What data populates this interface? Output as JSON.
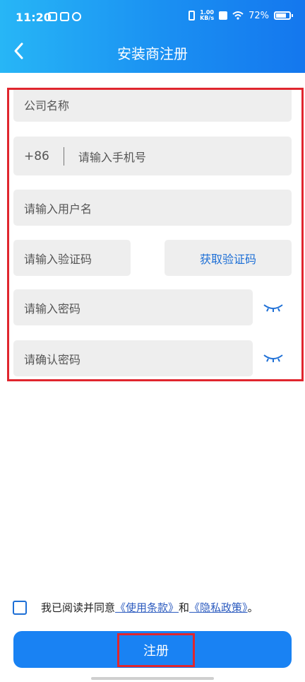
{
  "status": {
    "time": "11:20",
    "net_speed_top": "1.00",
    "net_speed_bottom": "KB/s",
    "battery": "72%"
  },
  "header": {
    "title": "安装商注册"
  },
  "form": {
    "company_placeholder": "公司名称",
    "phone_prefix": "+86",
    "phone_placeholder": "请输入手机号",
    "username_placeholder": "请输入用户名",
    "code_placeholder": "请输入验证码",
    "get_code_label": "获取验证码",
    "password_placeholder": "请输入密码",
    "confirm_password_placeholder": "请确认密码"
  },
  "agreement": {
    "prefix": "我已阅读并同意",
    "terms": "《使用条款》",
    "and": "和",
    "privacy": "《隐私政策》",
    "suffix": "。"
  },
  "actions": {
    "register_label": "注册"
  },
  "colors": {
    "accent": "#1982f3",
    "highlight_border": "#e0262e",
    "link": "#2c5bbf"
  }
}
